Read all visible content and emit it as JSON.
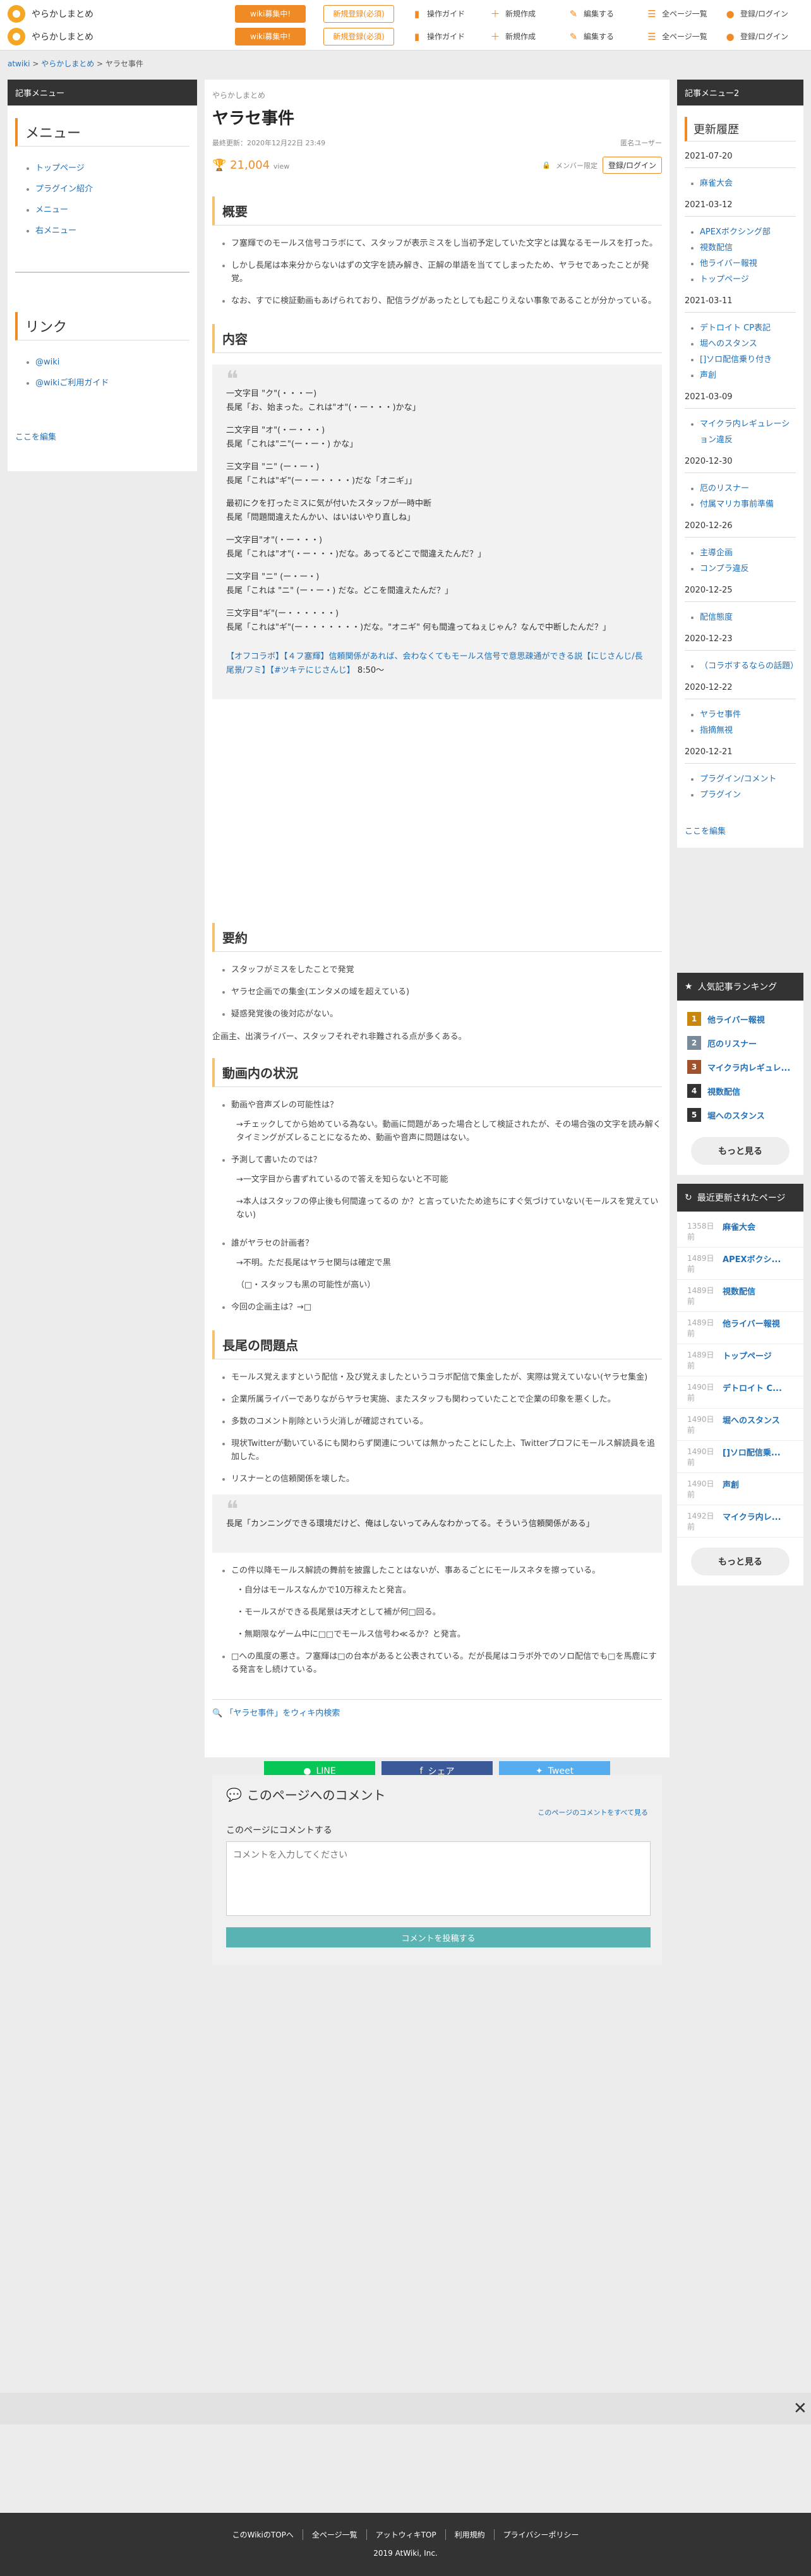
{
  "header": {
    "brand": "やらかしまとめ",
    "wiki_btn": "wiki募集中!",
    "reg_btn": "新規登録(必須)",
    "links": [
      "操作ガイド",
      "新規作成",
      "編集する",
      "全ページ一覧",
      "登録/ログイン"
    ]
  },
  "breadcrumb": [
    "atwiki",
    "やらかしまとめ",
    "ヤラセ事件"
  ],
  "left": {
    "head": "記事メニュー",
    "menu_title": "メニュー",
    "menu": [
      "トップページ",
      "プラグイン紹介",
      "メニュー",
      "右メニュー"
    ],
    "link_title": "リンク",
    "links": [
      "@wiki",
      "@wikiご利用ガイド"
    ],
    "edit": "ここを編集"
  },
  "article": {
    "category": "やらかしまとめ",
    "title": "ヤラセ事件",
    "updated": "最終更新：2020年12月22日 23:49",
    "author": "匿名ユーザー",
    "views": "21,004",
    "views_unit": "view",
    "member": "メンバー限定",
    "login": "登録/ログイン",
    "s1": "概要",
    "s1_items": [
      "フ塞輝でのモールス信号コラボにて、スタッフが表示ミスをし当初予定していた文字とは異なるモールスを打った。",
      "しかし長尾は本来分からないはずの文字を読み解き、正解の単語を当ててしまったため、ヤラセであったことが発覚。",
      "なお、すでに検証動画もあげられており、配信ラグがあったとしても起こりえない事象であることが分かっている。"
    ],
    "s2": "内容",
    "quote_lines": [
      "一文字目 \"ク\"(・・・ー)\n長尾「お、始まった。これは\"オ\"(・ー・・・)かな」",
      "二文字目 \"オ\"(・ー・・・)\n長尾「これは\"ニ\"(ー・ー・) かな」",
      "三文字目 \"ニ\" (ー・ー・)\n長尾「これは\"ギ\"(ー・ー・・・・)だな「オニギ」」",
      "最初にクを打ったミスに気が付いたスタッフが一時中断\n長尾「問題間違えたんかい、はいはいやり直しね」",
      "一文字目\"オ\"(・ー・・・)\n長尾「これは\"オ\"(・ー・・・)だな。あってるどこで間違えたんだ？」",
      "二文字目 \"ニ\" (ー・ー・)\n長尾「これは \"ニ\" (ー・ー・) だな。どこを間違えたんだ？」",
      "三文字目\"ギ\"(ー・・・・・・)\n長尾「これは\"ギ\"(ー・・・・・・・)だな。\"オニギ\" 何も間違ってねぇじゃん？なんで中断したんだ？」"
    ],
    "quote_link": "【オフコラボ】【４フ塞輝】信頼関係があれば、会わなくてもモールス信号で意思疎通ができる説【にじさんじ/長尾景/フミ】【#ツキテにじさんじ】",
    "quote_time": "8:50〜",
    "s3": "要約",
    "s3_items": [
      "スタッフがミスをしたことで発覚",
      "ヤラセ企画での集金(エンタメの域を超えている)",
      "疑惑発覚後の後対応がない。"
    ],
    "s3_note": "企画主、出演ライバー、スタッフそれぞれ非難される点が多くある。",
    "s4": "動画内の状況",
    "s4_items": [
      {
        "t": "動画や音声ズレの可能性は？",
        "sub": [
          "→チェックしてから始めている為ない。動画に問題があった場合として検証されたが、その場合強の文字を読み解くタイミングがズレることになるため、動画や音声に問題はない。"
        ]
      },
      {
        "t": "予測して書いたのでは？",
        "sub": [
          "→一文字目から書ずれているので答えを知らないと不可能",
          "→本人はスタッフの停止後も何間違ってるの か？と言っていたため途ちにすぐ気づけていない(モールスを覚えていない)"
        ]
      },
      {
        "t": "誰がヤラセの計画者？",
        "sub": [
          "→不明。ただ長尾はヤラセ関与は確定で黒",
          "（□・スタッフも黒の可能性が高い）"
        ]
      },
      {
        "t": "今回の企画主は？→□",
        "sub": []
      }
    ],
    "s5": "長尾の問題点",
    "s5_items": [
      "モールス覚えますという配信・及び覚えましたというコラボ配信で集金したが、実際は覚えていない(ヤラセ集金)",
      "企業所属ライバーでありながらヤラセ実施、またスタッフも関わっていたことで企業の印象を悪くした。",
      "多数のコメント削除という火消しが確認されている。",
      "現状Twitterが動いているにも関わらず関連については無かったことにした上、Twitterプロフにモールス解読員を追加した。",
      "リスナーとの信頼関係を壊した。"
    ],
    "s5_quote": "長尾「カンニングできる環境だけど、俺はしないってみんなわかってる。そういう信頼関係がある」",
    "s5_items2": [
      {
        "t": "この件以降モールス解読の舞前を披露したことはないが、事あるごとにモールスネタを擦っている。",
        "sub": [
          "・自分はモールスなんかで10万稼えたと発言。",
          "・モールスができる長尾景は天才として補が何□回る。",
          "・無期限なゲーム中に□□でモールス信号わ≪るか？と発言。"
        ]
      },
      {
        "t": "□への風度の悪さ。フ塞輝は□の台本があると公表されている。だが長尾はコラボ外でのソロ配信でも□を馬鹿にする発言をし続けている。",
        "sub": []
      }
    ],
    "search_link": "「ヤラセ事件」をウィキ内検索",
    "share": [
      "LINE",
      "シェア",
      "Tweet"
    ]
  },
  "comments": {
    "title": "このページへのコメント",
    "all": "このページのコメントをすべて見る",
    "label": "このページにコメントする",
    "placeholder": "コメントを入力してください",
    "submit": "コメントを投稿する"
  },
  "right": {
    "head": "記事メニュー2",
    "title": "更新履歴",
    "groups": [
      {
        "date": "2021-07-20",
        "items": [
          "麻雀大会"
        ]
      },
      {
        "date": "2021-03-12",
        "items": [
          "APEXボクシング部",
          "視数配信",
          "他ライバー報視",
          "トップページ"
        ]
      },
      {
        "date": "2021-03-11",
        "items": [
          "デトロイト CP表記",
          "堀へのスタンス",
          "[]ソロ配信乗り付き",
          "声創"
        ]
      },
      {
        "date": "2021-03-09",
        "items": [
          "マイクラ内レギュレーション違反"
        ]
      },
      {
        "date": "2020-12-30",
        "items": [
          "厄のリスナー",
          "付属マリカ事前準備"
        ]
      },
      {
        "date": "2020-12-26",
        "items": [
          "主導企画",
          "コンプラ違反"
        ]
      },
      {
        "date": "2020-12-25",
        "items": [
          "配信態度"
        ]
      },
      {
        "date": "2020-12-23",
        "items": [
          "（コラボするならの話題）"
        ]
      },
      {
        "date": "2020-12-22",
        "items": [
          "ヤラセ事件",
          "指摘無視"
        ]
      },
      {
        "date": "2020-12-21",
        "items": [
          "プラグイン/コメント",
          "プラグイン"
        ]
      }
    ],
    "edit": "ここを編集"
  },
  "ranking": {
    "title": "人気記事ランキング",
    "items": [
      "他ライバー報視",
      "厄のリスナー",
      "マイクラ内レギュレ...",
      "視数配信",
      "堀へのスタンス"
    ],
    "colors": [
      "#c8860b",
      "#7a8a99",
      "#a0522d",
      "#333333",
      "#333333"
    ],
    "more": "もっと見る"
  },
  "recent": {
    "title": "最近更新されたページ",
    "items": [
      {
        "ago": "1358日前",
        "name": "麻雀大会"
      },
      {
        "ago": "1489日前",
        "name": "APEXボクシ..."
      },
      {
        "ago": "1489日前",
        "name": "視数配信"
      },
      {
        "ago": "1489日前",
        "name": "他ライバー報視"
      },
      {
        "ago": "1489日前",
        "name": "トップページ"
      },
      {
        "ago": "1490日前",
        "name": "デトロイト C..."
      },
      {
        "ago": "1490日前",
        "name": "堀へのスタンス"
      },
      {
        "ago": "1490日前",
        "name": "[]ソロ配信乗..."
      },
      {
        "ago": "1490日前",
        "name": "声創"
      },
      {
        "ago": "1492日前",
        "name": "マイクラ内レ..."
      }
    ],
    "more": "もっと見る"
  },
  "footer": {
    "links": [
      "このWikiのTOPへ",
      "全ページ一覧",
      "アットウィキTOP",
      "利用規約",
      "プライバシーポリシー"
    ],
    "copyright": "2019 AtWiki, Inc."
  }
}
